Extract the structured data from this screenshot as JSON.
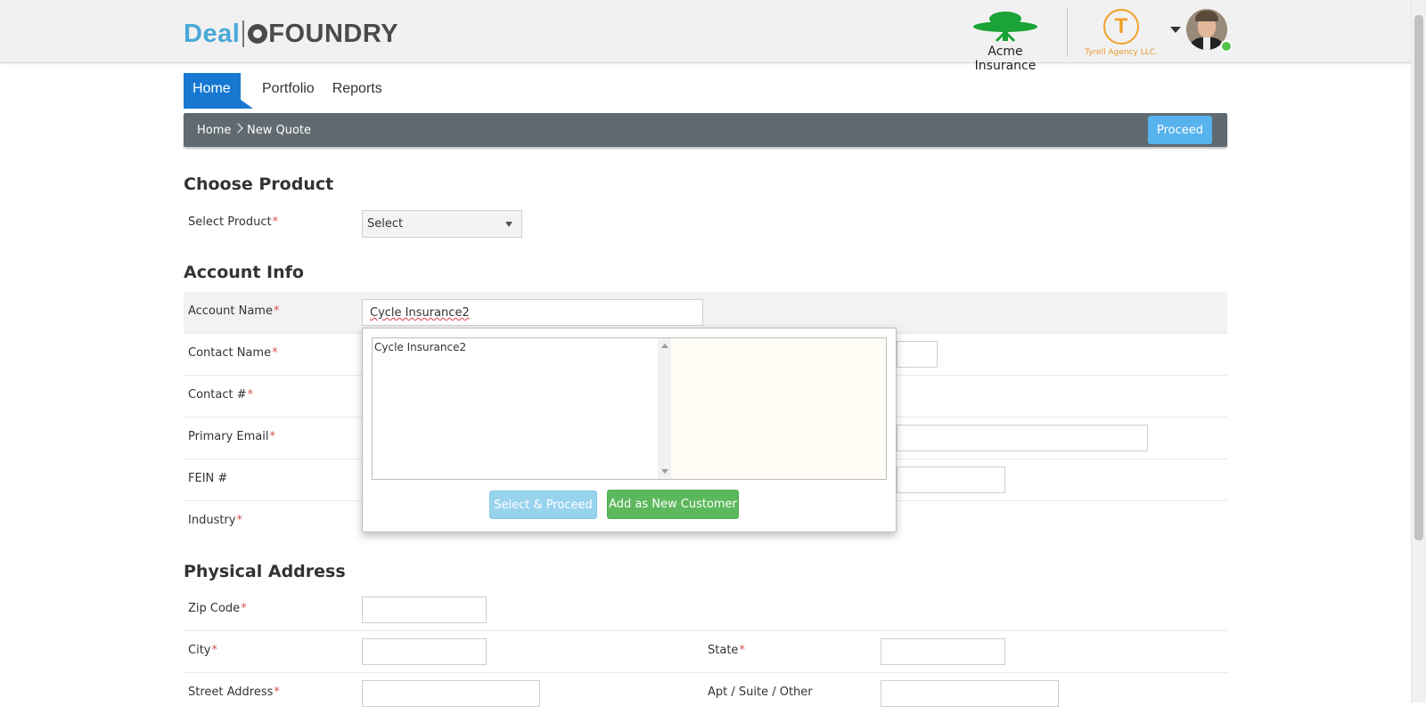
{
  "header": {
    "logo": {
      "part1": "Deal",
      "part2": "FOUNDRY"
    },
    "carrier": {
      "name": "Acme Insurance",
      "icon": "tree-icon",
      "color": "#1aa336"
    },
    "agency": {
      "name": "Tyrell Agency LLC.",
      "initial": "T",
      "color": "#f0a028"
    },
    "user_menu": {
      "icon": "caret-down-icon",
      "status": "online"
    }
  },
  "nav": {
    "tabs": [
      {
        "label": "Home",
        "active": true
      },
      {
        "label": "Portfolio"
      },
      {
        "label": "Reports"
      }
    ]
  },
  "breadcrumb": {
    "items": [
      "Home",
      "New Quote"
    ],
    "proceed_label": "Proceed"
  },
  "choose_product": {
    "title": "Choose Product",
    "select_product_label": "Select Product",
    "select_product_value": "Select"
  },
  "account_info": {
    "title": "Account Info",
    "account_name_label": "Account Name",
    "account_name_value": "Cycle Insurance2",
    "contact_name_label": "Contact Name",
    "contact_num_label": "Contact #",
    "primary_email_label": "Primary Email",
    "fein_label": "FEIN #",
    "industry_label": "Industry"
  },
  "popup": {
    "results": [
      "Cycle Insurance2"
    ],
    "select_proceed_label": "Select & Proceed",
    "add_new_label": "Add as New Customer"
  },
  "physical_address": {
    "title": "Physical Address",
    "zip_label": "Zip Code",
    "city_label": "City",
    "state_label": "State",
    "street_label": "Street Address",
    "apt_label": "Apt / Suite / Other"
  },
  "required_mark": "*"
}
